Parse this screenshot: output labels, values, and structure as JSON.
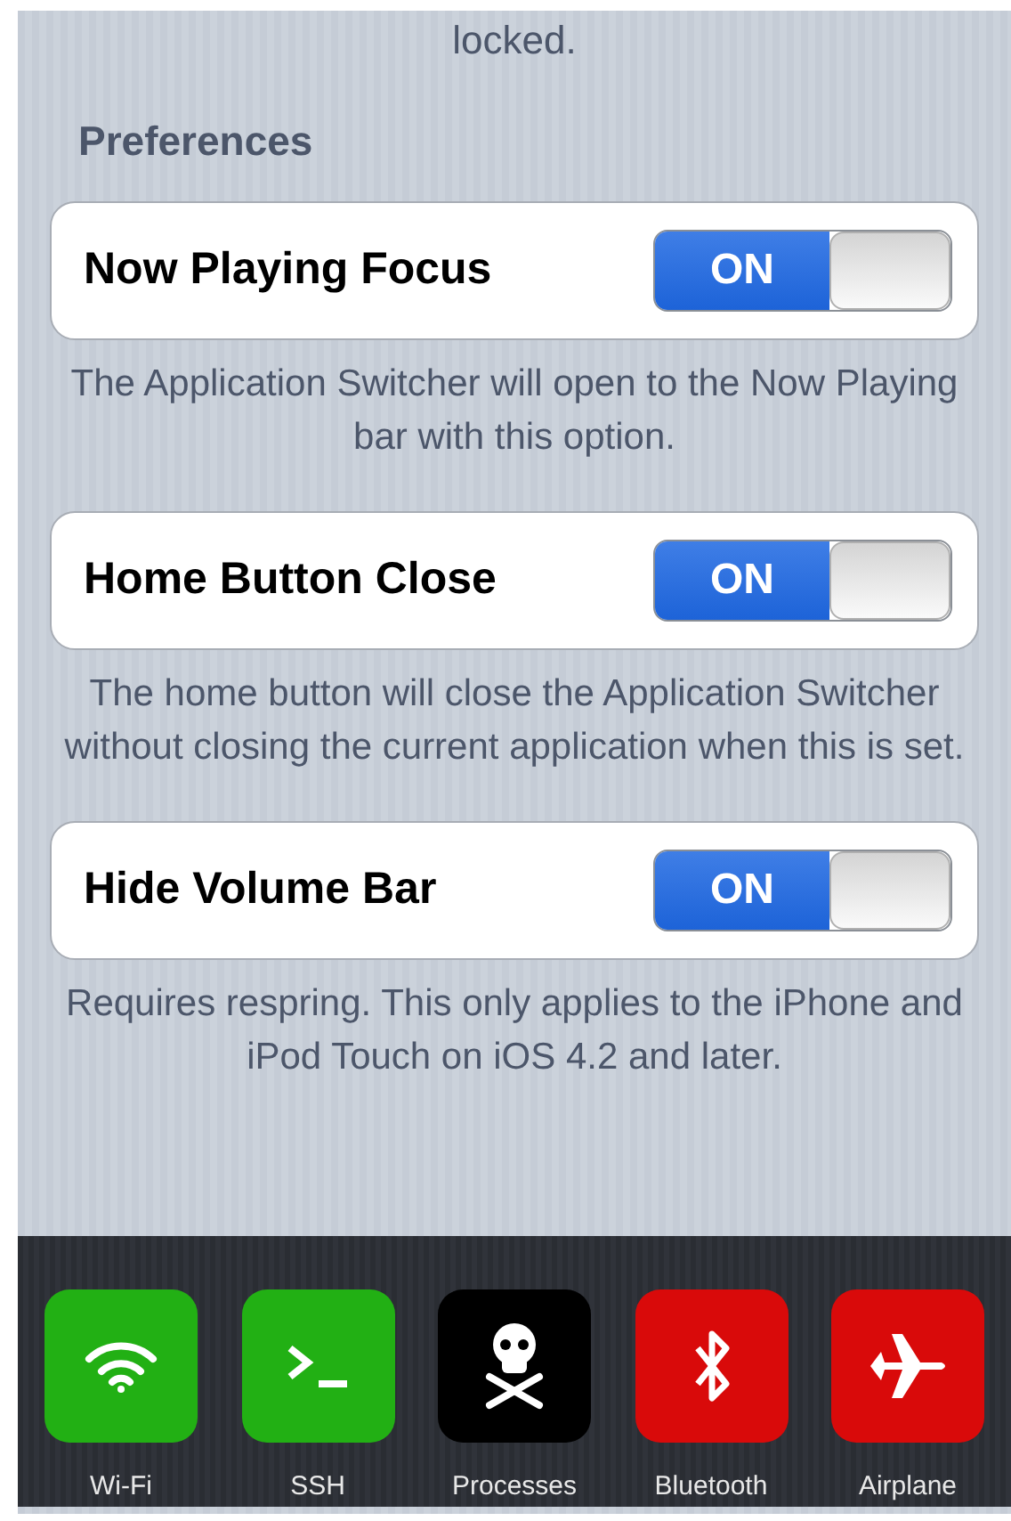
{
  "top_note": "locked.",
  "section_title": "Preferences",
  "settings": [
    {
      "label": "Now Playing Focus",
      "on": true,
      "switch_text": "ON",
      "description": "The Application Switcher will open to the Now Playing bar with this option."
    },
    {
      "label": "Home Button Close",
      "on": true,
      "switch_text": "ON",
      "description": "The home button will close the Application Switcher without closing the current application when this is set."
    },
    {
      "label": "Hide Volume Bar",
      "on": true,
      "switch_text": "ON",
      "description": "Requires respring. This only applies to the iPhone and iPod Touch on iOS 4.2 and later."
    }
  ],
  "dock": [
    {
      "kind": "wifi",
      "label": "Wi-Fi",
      "color": "#22b014"
    },
    {
      "kind": "terminal",
      "label": "SSH",
      "color": "#22b014"
    },
    {
      "kind": "skull",
      "label": "Processes",
      "color": "#000000"
    },
    {
      "kind": "bluetooth",
      "label": "Bluetooth",
      "color": "#d90a0a"
    },
    {
      "kind": "airplane",
      "label": "Airplane",
      "color": "#d90a0a"
    }
  ]
}
